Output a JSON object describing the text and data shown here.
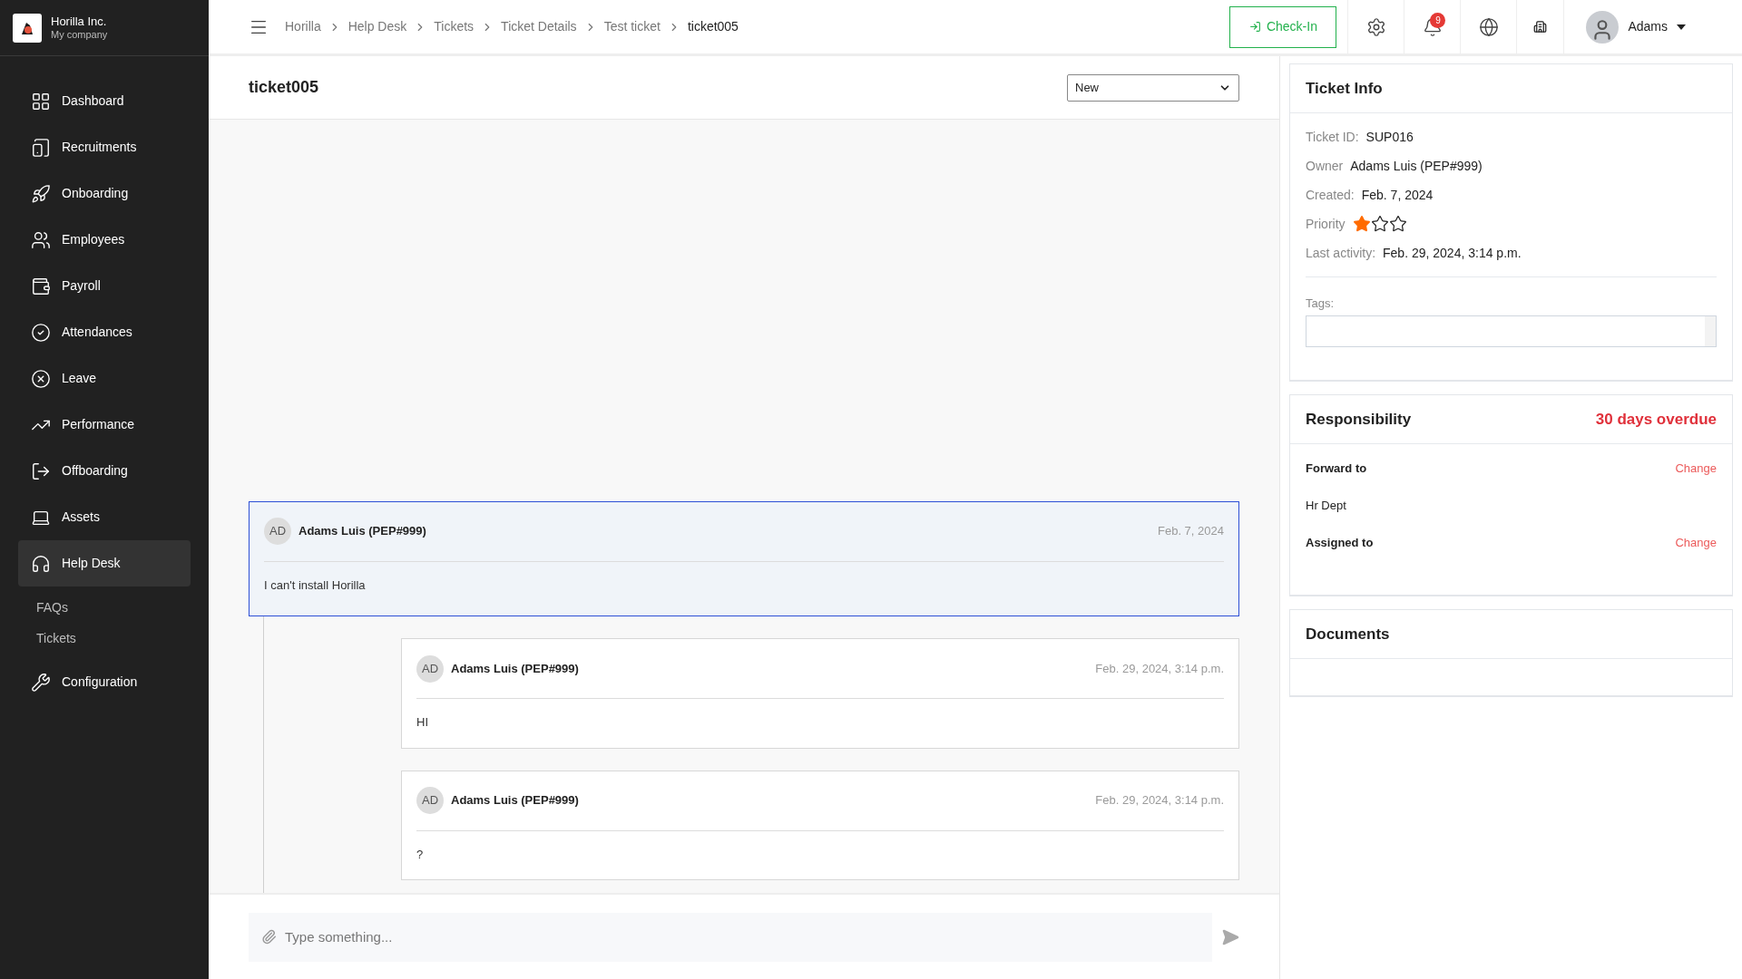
{
  "company": {
    "name": "Horilla Inc.",
    "subtitle": "My company"
  },
  "sidebar": {
    "items": [
      {
        "label": "Dashboard",
        "selected": false
      },
      {
        "label": "Recruitments",
        "selected": false
      },
      {
        "label": "Onboarding",
        "selected": false
      },
      {
        "label": "Employees",
        "selected": false
      },
      {
        "label": "Payroll",
        "selected": false
      },
      {
        "label": "Attendances",
        "selected": false
      },
      {
        "label": "Leave",
        "selected": false
      },
      {
        "label": "Performance",
        "selected": false
      },
      {
        "label": "Offboarding",
        "selected": false
      },
      {
        "label": "Assets",
        "selected": false
      },
      {
        "label": "Help Desk",
        "selected": true,
        "children": [
          {
            "label": "FAQs"
          },
          {
            "label": "Tickets"
          }
        ]
      },
      {
        "label": "Configuration",
        "selected": false
      }
    ]
  },
  "breadcrumbs": [
    "Horilla",
    "Help Desk",
    "Tickets",
    "Ticket Details",
    "Test ticket",
    "ticket005"
  ],
  "topbar": {
    "check_in": "Check-In",
    "notifications": "9",
    "user": "Adams"
  },
  "ticket": {
    "title": "ticket005",
    "status": "New"
  },
  "messages": [
    {
      "initials": "AD",
      "author": "Adams Luis (PEP#999)",
      "date": "Feb. 7, 2024",
      "text": "I can't install Horilla",
      "selected": true,
      "replies": [
        {
          "initials": "AD",
          "author": "Adams Luis (PEP#999)",
          "date": "Feb. 29, 2024, 3:14 p.m.",
          "text": "HI",
          "selected": false
        },
        {
          "initials": "AD",
          "author": "Adams Luis (PEP#999)",
          "date": "Feb. 29, 2024, 3:14 p.m.",
          "text": "?",
          "selected": false
        }
      ]
    }
  ],
  "composer": {
    "placeholder": "Type something..."
  },
  "ticket_info": {
    "title": "Ticket Info",
    "fields": [
      {
        "kind": "text",
        "label": "Ticket ID:",
        "value": "SUP016"
      },
      {
        "kind": "text",
        "label": "Owner",
        "value": "Adams Luis (PEP#999)"
      },
      {
        "kind": "text",
        "label": "Created:",
        "value": "Feb. 7, 2024"
      },
      {
        "kind": "stars",
        "label": "Priority",
        "stars": 1
      },
      {
        "kind": "text",
        "label": "Last activity:",
        "value": "Feb. 29, 2024, 3:14 p.m."
      }
    ],
    "tags_label": "Tags:"
  },
  "responsibility": {
    "title": "Responsibility",
    "overdue": "30 days overdue",
    "sections": [
      {
        "label": "Forward to",
        "action": "Change",
        "value": "Hr Dept"
      },
      {
        "label": "Assigned to",
        "action": "Change"
      }
    ]
  },
  "documents": {
    "title": "Documents"
  }
}
